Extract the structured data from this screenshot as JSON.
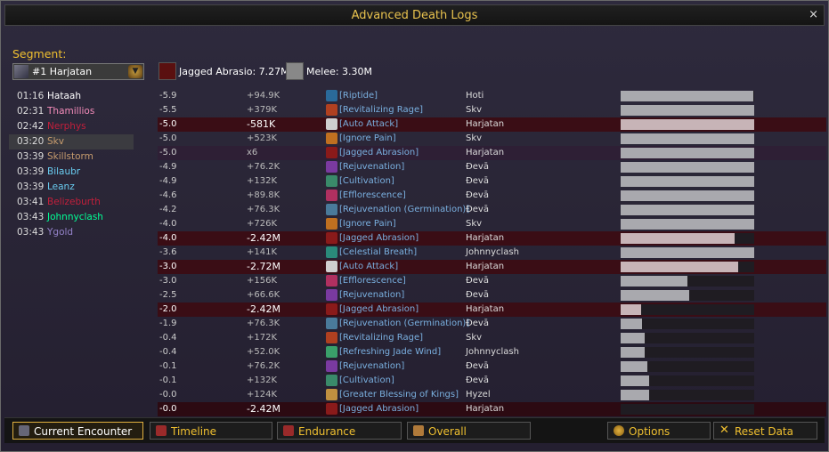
{
  "window": {
    "title": "Advanced Death Logs",
    "close_label": "×"
  },
  "segment": {
    "label": "Segment:",
    "selected": "#1 Harjatan"
  },
  "killers": [
    {
      "icon": "claw-icon",
      "text": "Jagged Abrasio: 7.27M",
      "color": "#8a1a1a"
    },
    {
      "icon": "sword-icon",
      "text": "Melee: 3.30M",
      "color": "#bbbbbb"
    }
  ],
  "deaths": [
    {
      "time": "01:16",
      "name": "Hataah",
      "color": "#ffffff"
    },
    {
      "time": "02:31",
      "name": "Thamillios",
      "color": "#f58cba"
    },
    {
      "time": "02:42",
      "name": "Nerphys",
      "color": "#c41f3b"
    },
    {
      "time": "03:20",
      "name": "Skv",
      "color": "#c79c6e"
    },
    {
      "time": "03:39",
      "name": "Skillstorm",
      "color": "#c79c6e"
    },
    {
      "time": "03:39",
      "name": "Bilaubr",
      "color": "#69ccf0"
    },
    {
      "time": "03:39",
      "name": "Leanz",
      "color": "#69ccf0"
    },
    {
      "time": "03:41",
      "name": "Belizeburth",
      "color": "#c41f3b"
    },
    {
      "time": "03:43",
      "name": "Johnnyclash",
      "color": "#00ff96"
    },
    {
      "time": "03:43",
      "name": "Ygold",
      "color": "#9482c9"
    }
  ],
  "log": [
    {
      "time": "-5.9",
      "amount": "+94.9K",
      "spell": "[Riptide]",
      "source": "Hoti",
      "kind": "heal",
      "health": 0.99,
      "icon": "#2a6a9a"
    },
    {
      "time": "-5.5",
      "amount": "+379K",
      "spell": "[Revitalizing Rage]",
      "source": "Skv",
      "kind": "heal",
      "health": 1.0,
      "icon": "#b04020"
    },
    {
      "time": "-5.0",
      "amount": "-581K",
      "spell": "[Auto Attack]",
      "source": "Harjatan",
      "kind": "dmg",
      "health": 1.0,
      "icon": "#cfcfcf"
    },
    {
      "time": "-5.0",
      "amount": "+523K",
      "spell": "[Ignore Pain]",
      "source": "Skv",
      "kind": "heal",
      "health": 1.0,
      "icon": "#c07020"
    },
    {
      "time": "-5.0",
      "amount": "x6",
      "spell": "[Jagged Abrasion]",
      "source": "Harjatan",
      "kind": "hi",
      "health": 1.0,
      "icon": "#8a1a1a"
    },
    {
      "time": "-4.9",
      "amount": "+76.2K",
      "spell": "[Rejuvenation]",
      "source": "Đevā",
      "kind": "heal",
      "health": 1.0,
      "icon": "#7a3aa0"
    },
    {
      "time": "-4.9",
      "amount": "+132K",
      "spell": "[Cultivation]",
      "source": "Đevā",
      "kind": "heal",
      "health": 1.0,
      "icon": "#3a8a6a"
    },
    {
      "time": "-4.6",
      "amount": "+89.8K",
      "spell": "[Efflorescence]",
      "source": "Đevā",
      "kind": "heal",
      "health": 1.0,
      "icon": "#b03060"
    },
    {
      "time": "-4.2",
      "amount": "+76.3K",
      "spell": "[Rejuvenation (Germination)]",
      "source": "Đevā",
      "kind": "heal",
      "health": 1.0,
      "icon": "#4a7a9a"
    },
    {
      "time": "-4.0",
      "amount": "+726K",
      "spell": "[Ignore Pain]",
      "source": "Skv",
      "kind": "heal",
      "health": 1.0,
      "icon": "#c07020"
    },
    {
      "time": "-4.0",
      "amount": "-2.42M",
      "spell": "[Jagged Abrasion]",
      "source": "Harjatan",
      "kind": "dmg",
      "health": 0.85,
      "icon": "#8a1a1a"
    },
    {
      "time": "-3.6",
      "amount": "+141K",
      "spell": "[Celestial Breath]",
      "source": "Johnnyclash",
      "kind": "heal",
      "health": 1.0,
      "icon": "#2a8a7a"
    },
    {
      "time": "-3.0",
      "amount": "-2.72M",
      "spell": "[Auto Attack]",
      "source": "Harjatan",
      "kind": "dmg",
      "health": 0.88,
      "icon": "#cfcfcf"
    },
    {
      "time": "-3.0",
      "amount": "+156K",
      "spell": "[Efflorescence]",
      "source": "Đevā",
      "kind": "heal",
      "health": 0.5,
      "icon": "#b03060"
    },
    {
      "time": "-2.5",
      "amount": "+66.6K",
      "spell": "[Rejuvenation]",
      "source": "Đevā",
      "kind": "heal",
      "health": 0.51,
      "icon": "#7a3aa0"
    },
    {
      "time": "-2.0",
      "amount": "-2.42M",
      "spell": "[Jagged Abrasion]",
      "source": "Harjatan",
      "kind": "dmg",
      "health": 0.15,
      "icon": "#8a1a1a"
    },
    {
      "time": "-1.9",
      "amount": "+76.3K",
      "spell": "[Rejuvenation (Germination)]",
      "source": "Đevā",
      "kind": "heal",
      "health": 0.16,
      "icon": "#4a7a9a"
    },
    {
      "time": "-0.4",
      "amount": "+172K",
      "spell": "[Revitalizing Rage]",
      "source": "Skv",
      "kind": "heal",
      "health": 0.18,
      "icon": "#b04020"
    },
    {
      "time": "-0.4",
      "amount": "+52.0K",
      "spell": "[Refreshing Jade Wind]",
      "source": "Johnnyclash",
      "kind": "heal",
      "health": 0.18,
      "icon": "#3aa06a"
    },
    {
      "time": "-0.1",
      "amount": "+76.2K",
      "spell": "[Rejuvenation]",
      "source": "Đevā",
      "kind": "heal",
      "health": 0.2,
      "icon": "#7a3aa0"
    },
    {
      "time": "-0.1",
      "amount": "+132K",
      "spell": "[Cultivation]",
      "source": "Đevā",
      "kind": "heal",
      "health": 0.21,
      "icon": "#3a8a6a"
    },
    {
      "time": "-0.0",
      "amount": "+124K",
      "spell": "[Greater Blessing of Kings]",
      "source": "Hyzel",
      "kind": "heal",
      "health": 0.21,
      "icon": "#c09040"
    },
    {
      "time": "-0.0",
      "amount": "-2.42M",
      "spell": "[Jagged Abrasion]",
      "source": "Harjatan",
      "kind": "dmg",
      "health": 0.0,
      "icon": "#8a1a1a"
    }
  ],
  "tabs": [
    {
      "label": "Current Encounter",
      "icon": "skull-icon",
      "active": true,
      "color": "#667"
    },
    {
      "label": "Timeline",
      "icon": "sword-icon",
      "active": false,
      "color": "#9a2a2a"
    },
    {
      "label": "Endurance",
      "icon": "shield-icon",
      "active": false,
      "color": "#9a2a2a"
    },
    {
      "label": "Overall",
      "icon": "tombstone-icon",
      "active": false,
      "color": "#b07a3a"
    }
  ],
  "buttons": {
    "options": "Options",
    "reset": "Reset Data"
  }
}
